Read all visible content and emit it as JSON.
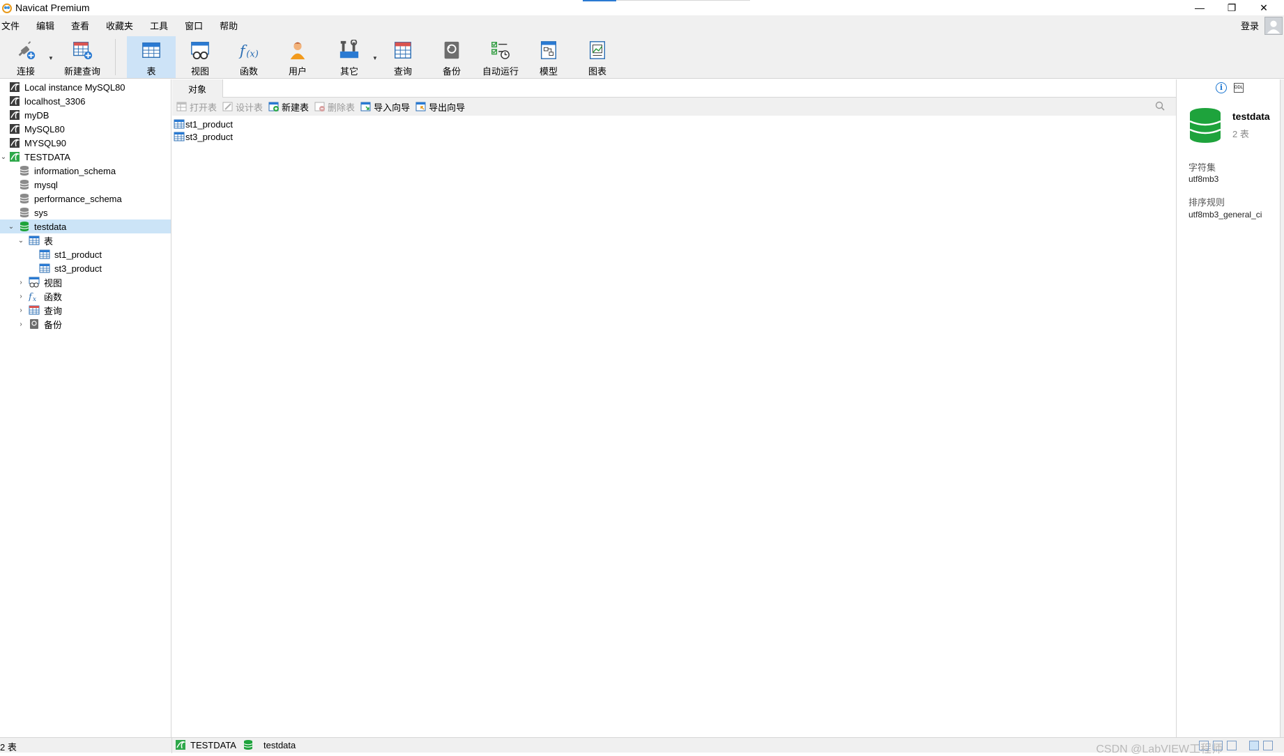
{
  "app": {
    "title": "Navicat Premium"
  },
  "window_controls": {
    "minimize": "—",
    "restore": "❐",
    "close": "✕"
  },
  "menu": [
    "文件",
    "编辑",
    "查看",
    "收藏夹",
    "工具",
    "窗口",
    "帮助"
  ],
  "login": "登录",
  "toolbar": {
    "connect": "连接",
    "new_query": "新建查询",
    "table": "表",
    "view": "视图",
    "function": "函数",
    "user": "用户",
    "other": "其它",
    "query": "查询",
    "backup": "备份",
    "automation": "自动运行",
    "model": "模型",
    "chart": "图表"
  },
  "tree": {
    "connections": [
      {
        "label": "Local instance MySQL80"
      },
      {
        "label": "localhost_3306"
      },
      {
        "label": "myDB"
      },
      {
        "label": "MySQL80"
      },
      {
        "label": "MYSQL90"
      },
      {
        "label": "TESTDATA"
      }
    ],
    "databases": [
      {
        "label": "information_schema"
      },
      {
        "label": "mysql"
      },
      {
        "label": "performance_schema"
      },
      {
        "label": "sys"
      },
      {
        "label": "testdata"
      }
    ],
    "tables_folder": "表",
    "tables": [
      {
        "label": "st1_product"
      },
      {
        "label": "st3_product"
      }
    ],
    "views_folder": "视图",
    "functions_folder": "函数",
    "queries_folder": "查询",
    "backups_folder": "备份"
  },
  "center": {
    "tab_objects": "对象",
    "actions": {
      "open_table": "打开表",
      "design_table": "设计表",
      "new_table": "新建表",
      "delete_table": "删除表",
      "import_wizard": "导入向导",
      "export_wizard": "导出向导"
    },
    "objects": [
      {
        "label": "st1_product"
      },
      {
        "label": "st3_product"
      }
    ]
  },
  "info_panel": {
    "name": "testdata",
    "count": "2 表",
    "charset_label": "字符集",
    "charset_value": "utf8mb3",
    "collation_label": "排序规则",
    "collation_value": "utf8mb3_general_ci"
  },
  "status": {
    "count": "2 表",
    "connection": "TESTDATA",
    "database": "testdata",
    "watermark": "CSDN @LabVIEW工程师"
  },
  "colors": {
    "selection": "#cce4f7",
    "active_toolbar": "#cde3f7",
    "db_green": "#1ea33c",
    "accent_blue": "#1e78d2"
  }
}
